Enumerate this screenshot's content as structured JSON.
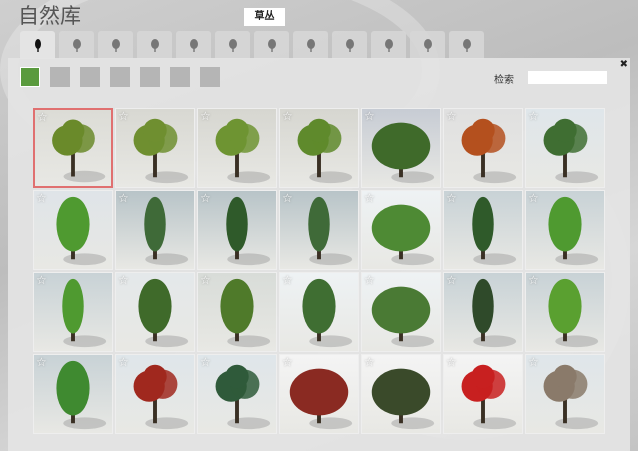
{
  "title": "自然库",
  "tooltip": "草丛",
  "tabs": [
    "tree-small-icon",
    "tree-round-icon",
    "tree-broad-icon",
    "conifer-icon",
    "palm-icon",
    "grass-icon",
    "reed-icon",
    "flower-icon",
    "cactus-icon",
    "shrub-icon",
    "forest-icon",
    "leaf-tree-icon"
  ],
  "swatch_count": 7,
  "accent": "#5a9a3e",
  "search_label": "检索",
  "search_value": "",
  "close": "✖",
  "tiles": [
    {
      "c": "#6a8a2a",
      "bg": "#dcdcd6",
      "shape": "round"
    },
    {
      "c": "#6f8f30",
      "bg": "#d8d8d2",
      "shape": "round"
    },
    {
      "c": "#6e9432",
      "bg": "#d6d6d0",
      "shape": "round"
    },
    {
      "c": "#5f8a2c",
      "bg": "#d6d6d0",
      "shape": "round"
    },
    {
      "c": "#3f6a2a",
      "bg": "#c7ccd4",
      "shape": "bush"
    },
    {
      "c": "#b4501e",
      "bg": "#e0e0e0",
      "shape": "round"
    },
    {
      "c": "#3f6e32",
      "bg": "#dfe6ea",
      "shape": "round"
    },
    {
      "c": "#4f9a30",
      "bg": "#dfe4e8",
      "shape": "tall"
    },
    {
      "c": "#3f6a38",
      "bg": "#b8c4c8",
      "shape": "slim"
    },
    {
      "c": "#2f5a2a",
      "bg": "#b8c4c8",
      "shape": "slim"
    },
    {
      "c": "#3f6a38",
      "bg": "#b8c4c8",
      "shape": "slim"
    },
    {
      "c": "#4e8a34",
      "bg": "#eef2f4",
      "shape": "bush"
    },
    {
      "c": "#2f5a2a",
      "bg": "#c8d2d6",
      "shape": "slim"
    },
    {
      "c": "#4f9a30",
      "bg": "#c8d2d6",
      "shape": "tall"
    },
    {
      "c": "#4f9a30",
      "bg": "#c8d2d6",
      "shape": "slim"
    },
    {
      "c": "#3f6a2a",
      "bg": "#e4e8ea",
      "shape": "tall"
    },
    {
      "c": "#4f7a2a",
      "bg": "#d8dcd8",
      "shape": "tall"
    },
    {
      "c": "#3f6e32",
      "bg": "#eef2f4",
      "shape": "tall"
    },
    {
      "c": "#4a7a34",
      "bg": "#eef2f4",
      "shape": "bush"
    },
    {
      "c": "#2f4a2a",
      "bg": "#c8d2d6",
      "shape": "slim"
    },
    {
      "c": "#5aa030",
      "bg": "#c8d2d6",
      "shape": "tall"
    },
    {
      "c": "#3f8a30",
      "bg": "#c8d2d6",
      "shape": "tall"
    },
    {
      "c": "#a0281e",
      "bg": "#dfe6ea",
      "shape": "round"
    },
    {
      "c": "#2f5a3a",
      "bg": "#dfe6ea",
      "shape": "round"
    },
    {
      "c": "#8a2a22",
      "bg": "#f4f4f4",
      "shape": "bush"
    },
    {
      "c": "#3a4a2a",
      "bg": "#f4f4f4",
      "shape": "bush"
    },
    {
      "c": "#c82020",
      "bg": "#f4f4f4",
      "shape": "round"
    },
    {
      "c": "#8a7a6a",
      "bg": "#dfe6ea",
      "shape": "round"
    }
  ]
}
